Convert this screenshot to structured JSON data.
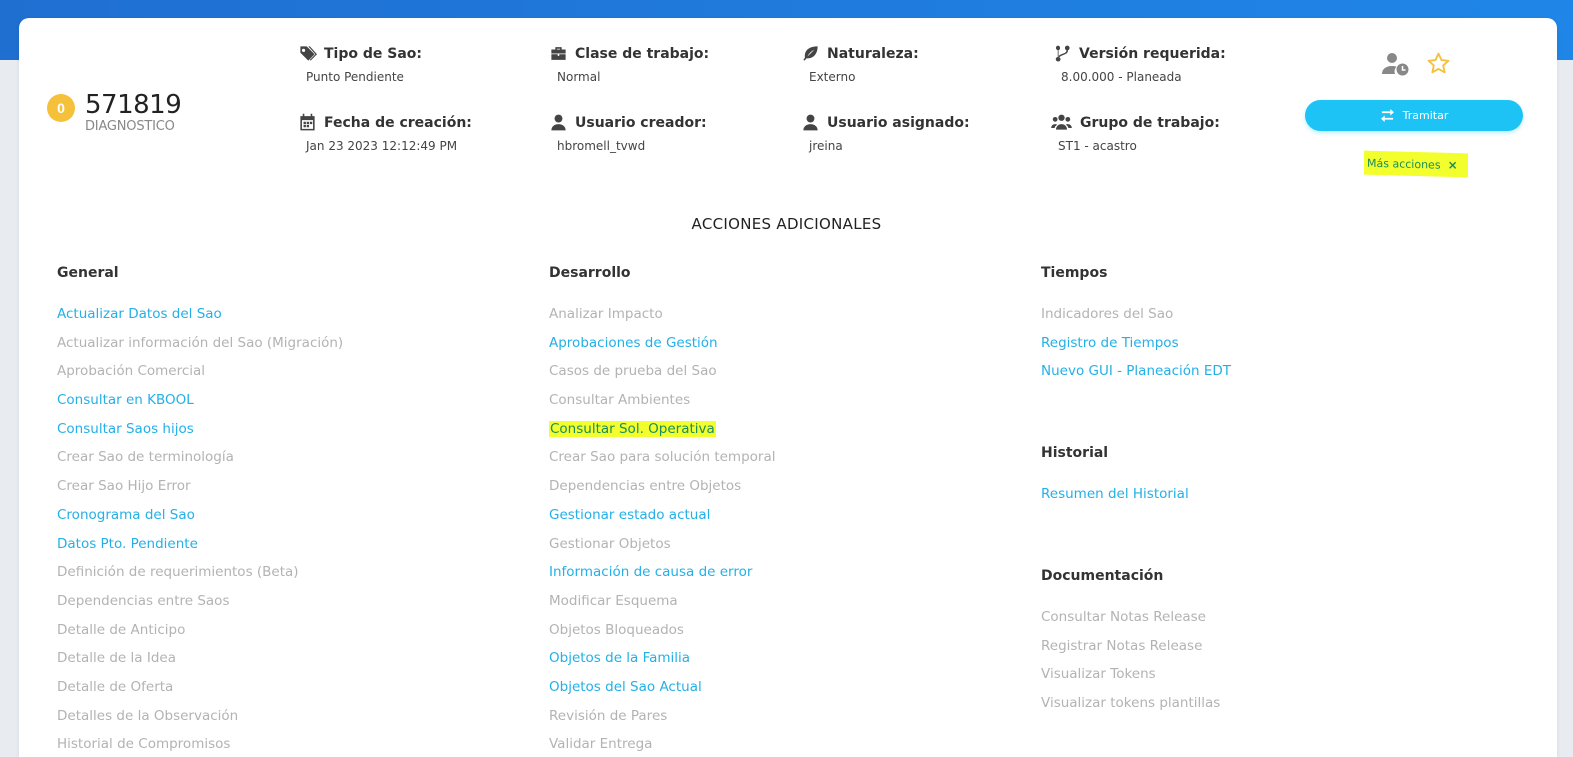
{
  "header": {
    "badge_count": "0",
    "sao_number": "571819",
    "sao_state": "DIAGNOSTICO",
    "fields": {
      "tipo": {
        "label": "Tipo de Sao:",
        "value": "Punto Pendiente"
      },
      "clase": {
        "label": "Clase de trabajo:",
        "value": "Normal"
      },
      "naturaleza": {
        "label": "Naturaleza:",
        "value": "Externo"
      },
      "version": {
        "label": "Versión requerida:",
        "value": "8.00.000 - Planeada"
      },
      "fecha": {
        "label": "Fecha de creación:",
        "value": "Jan 23 2023 12:12:49 PM"
      },
      "creador": {
        "label": "Usuario creador:",
        "value": "hbromell_tvwd"
      },
      "asignado": {
        "label": "Usuario asignado:",
        "value": "jreina"
      },
      "grupo": {
        "label": "Grupo de trabajo:",
        "value": "ST1 - acastro"
      }
    },
    "tramitar_label": "Tramitar",
    "mas_acciones_label": "Más acciones",
    "mas_acciones_close": "×"
  },
  "section_title": "ACCIONES ADICIONALES",
  "colors": {
    "enabled_link": "#23b0e8",
    "disabled_link": "#b3b3b3",
    "highlight": "#f3ff2d",
    "primary_button": "#1ec3f5",
    "badge": "#f5c13b"
  },
  "general": {
    "title": "General",
    "items": [
      {
        "label": "Actualizar Datos del Sao",
        "enabled": true
      },
      {
        "label": "Actualizar información del Sao (Migración)",
        "enabled": false
      },
      {
        "label": "Aprobación Comercial",
        "enabled": false
      },
      {
        "label": "Consultar en KBOOL",
        "enabled": true
      },
      {
        "label": "Consultar Saos hijos",
        "enabled": true
      },
      {
        "label": "Crear Sao de terminología",
        "enabled": false
      },
      {
        "label": "Crear Sao Hijo Error",
        "enabled": false
      },
      {
        "label": "Cronograma del Sao",
        "enabled": true
      },
      {
        "label": "Datos Pto. Pendiente",
        "enabled": true
      },
      {
        "label": "Definición de requerimientos (Beta)",
        "enabled": false
      },
      {
        "label": "Dependencias entre Saos",
        "enabled": false
      },
      {
        "label": "Detalle de Anticipo",
        "enabled": false
      },
      {
        "label": "Detalle de la Idea",
        "enabled": false
      },
      {
        "label": "Detalle de Oferta",
        "enabled": false
      },
      {
        "label": "Detalles de la Observación",
        "enabled": false
      },
      {
        "label": "Historial de Compromisos",
        "enabled": false
      }
    ]
  },
  "desarrollo": {
    "title": "Desarrollo",
    "items": [
      {
        "label": "Analizar Impacto",
        "enabled": false
      },
      {
        "label": "Aprobaciones de Gestión",
        "enabled": true
      },
      {
        "label": "Casos de prueba del Sao",
        "enabled": false
      },
      {
        "label": "Consultar Ambientes",
        "enabled": false
      },
      {
        "label": "Consultar Sol. Operativa",
        "enabled": true,
        "highlighted": true
      },
      {
        "label": "Crear Sao para solución temporal",
        "enabled": false
      },
      {
        "label": "Dependencias entre Objetos",
        "enabled": false
      },
      {
        "label": "Gestionar estado actual",
        "enabled": true
      },
      {
        "label": "Gestionar Objetos",
        "enabled": false
      },
      {
        "label": "Información de causa de error",
        "enabled": true
      },
      {
        "label": "Modificar Esquema",
        "enabled": false
      },
      {
        "label": "Objetos Bloqueados",
        "enabled": false
      },
      {
        "label": "Objetos de la Familia",
        "enabled": true
      },
      {
        "label": "Objetos del Sao Actual",
        "enabled": true
      },
      {
        "label": "Revisión de Pares",
        "enabled": false
      },
      {
        "label": "Validar Entrega",
        "enabled": false
      }
    ]
  },
  "tiempos": {
    "title": "Tiempos",
    "items": [
      {
        "label": "Indicadores del Sao",
        "enabled": false
      },
      {
        "label": "Registro de Tiempos",
        "enabled": true
      },
      {
        "label": "Nuevo GUI - Planeación EDT",
        "enabled": true
      }
    ]
  },
  "historial": {
    "title": "Historial",
    "items": [
      {
        "label": "Resumen del Historial",
        "enabled": true
      }
    ]
  },
  "documentacion": {
    "title": "Documentación",
    "items": [
      {
        "label": "Consultar Notas Release",
        "enabled": false
      },
      {
        "label": "Registrar Notas Release",
        "enabled": false
      },
      {
        "label": "Visualizar Tokens",
        "enabled": false
      },
      {
        "label": "Visualizar tokens plantillas",
        "enabled": false
      }
    ]
  }
}
